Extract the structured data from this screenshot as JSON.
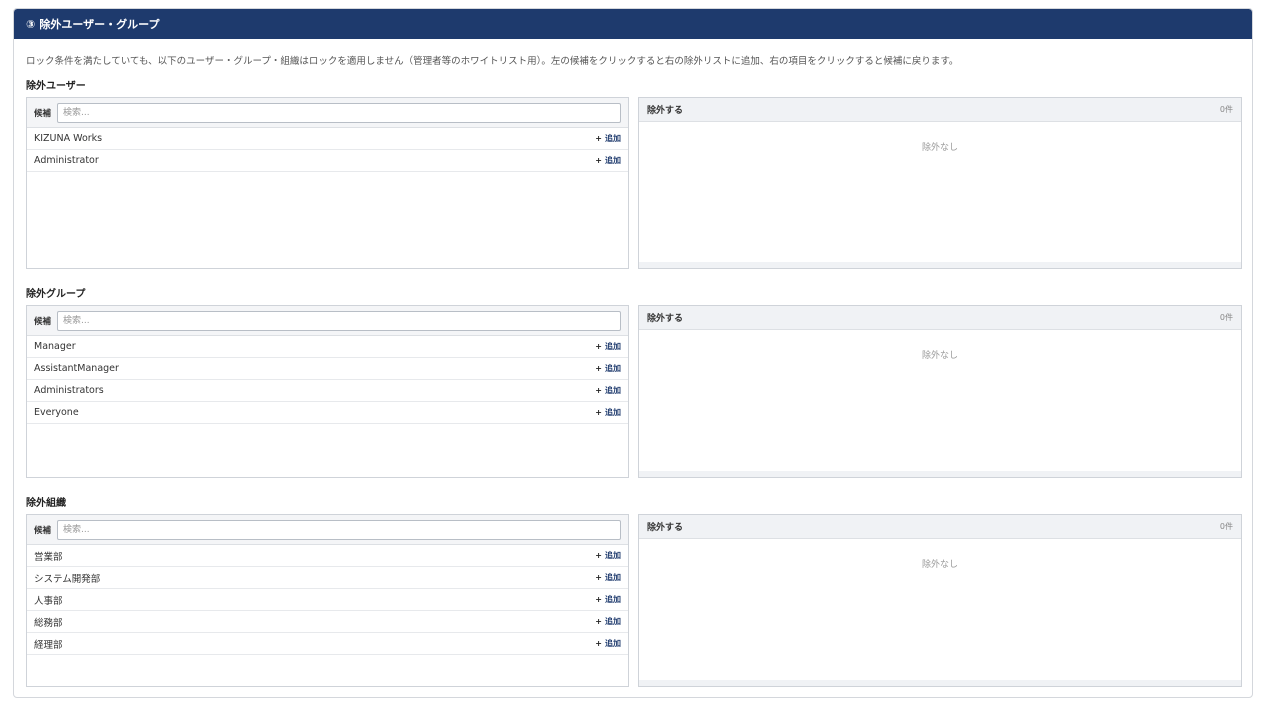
{
  "header": {
    "num": "③",
    "title": "除外ユーザー・グループ"
  },
  "description": "ロック条件を満たしていても、以下のユーザー・グループ・組織はロックを適用しません（管理者等のホワイトリスト用）。左の候補をクリックすると右の除外リストに追加、右の項目をクリックすると候補に戻ります。",
  "common": {
    "candidate_label": "候補",
    "search_placeholder": "検索...",
    "add_plus": "+",
    "add_label": "追加",
    "excluded_title": "除外する",
    "excluded_count": "0件",
    "empty_text": "除外なし"
  },
  "sections": [
    {
      "title": "除外ユーザー",
      "candidates": [
        "KIZUNA Works",
        "Administrator"
      ]
    },
    {
      "title": "除外グループ",
      "candidates": [
        "Manager",
        "AssistantManager",
        "Administrators",
        "Everyone"
      ]
    },
    {
      "title": "除外組織",
      "candidates": [
        "営業部",
        "システム開発部",
        "人事部",
        "総務部",
        "経理部"
      ]
    }
  ]
}
